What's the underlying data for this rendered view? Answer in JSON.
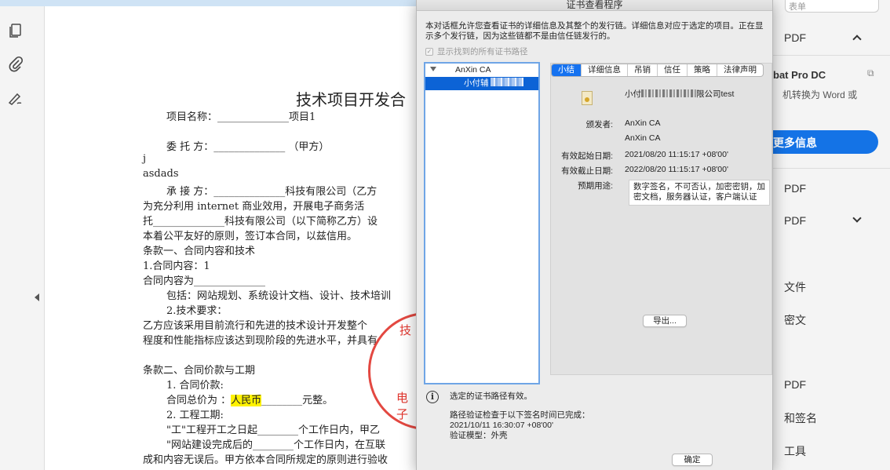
{
  "document": {
    "title": "技术项目开发合",
    "lines": [
      "项目名称：______________项目1",
      "委 托 方：______________  （甲方）",
      "j",
      "asdads",
      "承 接 方：______________科技有限公司（乙方",
      "为充分利用 internet 商业效用，开展电子商务活",
      "托______________科技有限公司（以下简称乙方）设",
      "本着公平友好的原则，签订本合同，以兹信用。",
      "条款一、合同内容和技术",
      "1.合同内容：1",
      "合同内容为______________",
      "包括：网站规划、系统设计文档、设计、技术培训",
      "2.技术要求：",
      "乙方应该采用目前流行和先进的技术设计开发整个",
      "程度和性能指标应该达到现阶段的先进水平，并具有",
      "条款二、合同价款与工期",
      "1. 合同价款:",
      "2. 工程工期:",
      "\"工\"工程开工之日起________个工作日内，甲乙",
      "\"网站建设完成后的________个工作日内，在互联",
      "成和内容无误后。甲方依本合同所规定的原则进行验收"
    ],
    "price_prefix": "合同总价为 ：",
    "price_highlight": "人民币",
    "price_suffix": "________元整。",
    "stamp_text": "电 子",
    "stamp_text2": "技"
  },
  "dialog": {
    "title": "证书查看程序",
    "description": "本对话框允许您查看证书的详细信息及其整个的发行链。详细信息对应于选定的项目。正在显示多个发行链，因为这些链都不是由信任链发行的。",
    "show_all_paths_label": "显示找到的所有证书路径",
    "show_all_paths_checked": true,
    "tree": [
      {
        "label": "AnXin CA",
        "expanded": true,
        "selected": false
      },
      {
        "label": "小付辅",
        "selected": true
      }
    ],
    "tabs": [
      "小结",
      "详细信息",
      "吊销",
      "信任",
      "策略",
      "法律声明"
    ],
    "active_tab": "小结",
    "subject_prefix": "小付",
    "subject_suffix": "限公司test",
    "fields": {
      "issuer_label": "颁发者:",
      "issuer_value": "AnXin CA",
      "issuer_value_2": "AnXin CA",
      "valid_from_label": "有效起始日期:",
      "valid_from_value": "2021/08/20 11:15:17 +08'00'",
      "valid_to_label": "有效截止日期:",
      "valid_to_value": "2022/08/20 11:15:17 +08'00'",
      "usage_label": "预期用途:",
      "usage_value": "数字签名，不可否认，加密密钥，加密文档，服务器认证，客户端认证"
    },
    "export_button": "导出...",
    "status_valid": "选定的证书路径有效。",
    "status_check_line1": "路径验证检查于以下签名时间已完成：",
    "status_check_time": "2021/10/11 16:30:07 +08'00'",
    "status_model": "验证模型：外壳",
    "ok_button": "确定"
  },
  "side_panel": {
    "search_hint": "表单",
    "items": [
      "PDF",
      "bat Pro DC",
      "机转换为 Word 或",
      "更多信息",
      "PDF",
      "PDF",
      "文件",
      "密文",
      "PDF",
      "和签名",
      "工具"
    ]
  },
  "left_rail": {
    "icons": [
      "pages-icon",
      "attachment-icon",
      "signature-icon"
    ]
  }
}
